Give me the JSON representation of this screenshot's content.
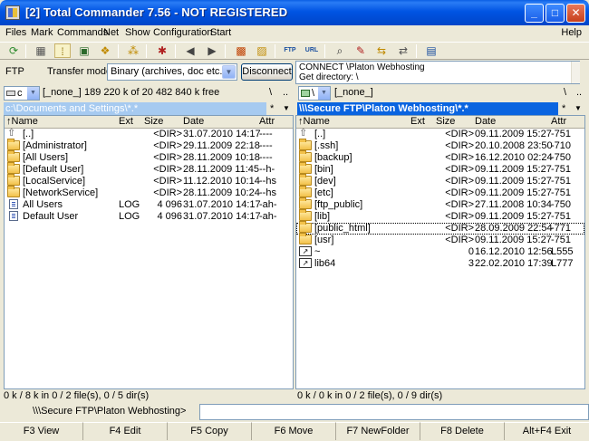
{
  "window": {
    "title": "[2] Total Commander 7.56 - NOT REGISTERED",
    "minimize": "_",
    "maximize": "□",
    "close": "✕"
  },
  "menu": {
    "items": [
      "Files",
      "Mark",
      "Commands",
      "Net",
      "Show",
      "Configuration",
      "Start"
    ],
    "help": "Help"
  },
  "toolbar": {
    "icons": [
      "refresh-icon",
      "brief-view-icon",
      "detailed-view-icon",
      "thumbnails-icon",
      "tree-icon",
      "invert-selection-icon",
      "unpack-icon",
      "back-icon",
      "forward-icon",
      "pack-icon",
      "unpack-files-icon",
      "ftp-connect-icon",
      "url-connect-icon",
      "search-icon",
      "multi-rename-icon",
      "compare-dirs-icon",
      "sync-dirs-icon",
      "notepad-icon"
    ]
  },
  "ftp": {
    "label": "FTP",
    "transfer_mode_label": "Transfer mode",
    "transfer_mode_value": "Binary (archives, doc etc.)",
    "disconnect_label": "Disconnect",
    "log_line1": "CONNECT \\Platon Webhosting",
    "log_line2": "Get directory: \\"
  },
  "left": {
    "drive": "c",
    "volume": "[_none_]",
    "free": "189 220 k of 20 482 840 k free",
    "root": "\\",
    "up": "..",
    "path": "c:\\Documents and Settings\\*.*",
    "star": "*",
    "sort": "▼",
    "columns": [
      "↑Name",
      "Ext",
      "Size",
      "Date",
      "Attr"
    ],
    "rows": [
      {
        "icon": "up",
        "name": "[..]",
        "ext": "",
        "size": "<DIR>",
        "date": "31.07.2010 14:17",
        "attr": "----"
      },
      {
        "icon": "folder",
        "name": "[Administrator]",
        "ext": "",
        "size": "<DIR>",
        "date": "29.11.2009 22:18",
        "attr": "----"
      },
      {
        "icon": "folder",
        "name": "[All Users]",
        "ext": "",
        "size": "<DIR>",
        "date": "28.11.2009 10:18",
        "attr": "----"
      },
      {
        "icon": "folder",
        "name": "[Default User]",
        "ext": "",
        "size": "<DIR>",
        "date": "28.11.2009 11:45",
        "attr": "--h-"
      },
      {
        "icon": "folder",
        "name": "[LocalService]",
        "ext": "",
        "size": "<DIR>",
        "date": "11.12.2010 10:14",
        "attr": "--hs"
      },
      {
        "icon": "folder",
        "name": "[NetworkService]",
        "ext": "",
        "size": "<DIR>",
        "date": "28.11.2009 10:24",
        "attr": "--hs"
      },
      {
        "icon": "file",
        "name": "All Users",
        "ext": "LOG",
        "size": "4 096",
        "date": "31.07.2010 14:17",
        "attr": "-ah-"
      },
      {
        "icon": "file",
        "name": "Default User",
        "ext": "LOG",
        "size": "4 096",
        "date": "31.07.2010 14:17",
        "attr": "-ah-"
      }
    ],
    "status": "0 k / 8 k in 0 / 2 file(s), 0 / 5 dir(s)"
  },
  "right": {
    "drive": "\\",
    "volume": "[_none_]",
    "root": "\\",
    "up": "..",
    "path": "\\\\\\Secure FTP\\Platon Webhosting\\*.*",
    "star": "*",
    "sort": "▼",
    "columns": [
      "↑Name",
      "Ext",
      "Size",
      "Date",
      "Attr"
    ],
    "rows": [
      {
        "icon": "up",
        "name": "[..]",
        "ext": "",
        "size": "<DIR>",
        "date": "09.11.2009 15:27",
        "attr": "-751"
      },
      {
        "icon": "folder",
        "name": "[.ssh]",
        "ext": "",
        "size": "<DIR>",
        "date": "20.10.2008 23:50",
        "attr": "-710"
      },
      {
        "icon": "folder",
        "name": "[backup]",
        "ext": "",
        "size": "<DIR>",
        "date": "16.12.2010 02:24",
        "attr": "-750"
      },
      {
        "icon": "folder",
        "name": "[bin]",
        "ext": "",
        "size": "<DIR>",
        "date": "09.11.2009 15:27",
        "attr": "-751"
      },
      {
        "icon": "folder",
        "name": "[dev]",
        "ext": "",
        "size": "<DIR>",
        "date": "09.11.2009 15:27",
        "attr": "-751"
      },
      {
        "icon": "folder",
        "name": "[etc]",
        "ext": "",
        "size": "<DIR>",
        "date": "09.11.2009 15:27",
        "attr": "-751"
      },
      {
        "icon": "folder",
        "name": "[ftp_public]",
        "ext": "",
        "size": "<DIR>",
        "date": "27.11.2008 10:34",
        "attr": "-750"
      },
      {
        "icon": "folder",
        "name": "[lib]",
        "ext": "",
        "size": "<DIR>",
        "date": "09.11.2009 15:27",
        "attr": "-751"
      },
      {
        "icon": "folder",
        "name": "[public_html]",
        "ext": "",
        "size": "<DIR>",
        "date": "28.09.2009 22:54",
        "attr": "-771"
      },
      {
        "icon": "folder",
        "name": "[usr]",
        "ext": "",
        "size": "<DIR>",
        "date": "09.11.2009 15:27",
        "attr": "-751"
      },
      {
        "icon": "link",
        "name": "~",
        "ext": "",
        "size": "0",
        "date": "16.12.2010 12:56",
        "attr": "L555"
      },
      {
        "icon": "link",
        "name": "lib64",
        "ext": "",
        "size": "3",
        "date": "22.02.2010 17:39",
        "attr": "L777"
      }
    ],
    "status": "0 k / 0 k in 0 / 2 file(s), 0 / 9 dir(s)"
  },
  "cmdline": {
    "path": "\\\\\\Secure FTP\\Platon Webhosting>",
    "value": ""
  },
  "fkeys": [
    "F3 View",
    "F4 Edit",
    "F5 Copy",
    "F6 Move",
    "F7 NewFolder",
    "F8 Delete",
    "Alt+F4 Exit"
  ],
  "colors": {
    "title_bar": "#0054e3",
    "active_path": "#0a64e0",
    "inactive_path": "#a6caf0",
    "window_bg": "#ece9d8"
  }
}
